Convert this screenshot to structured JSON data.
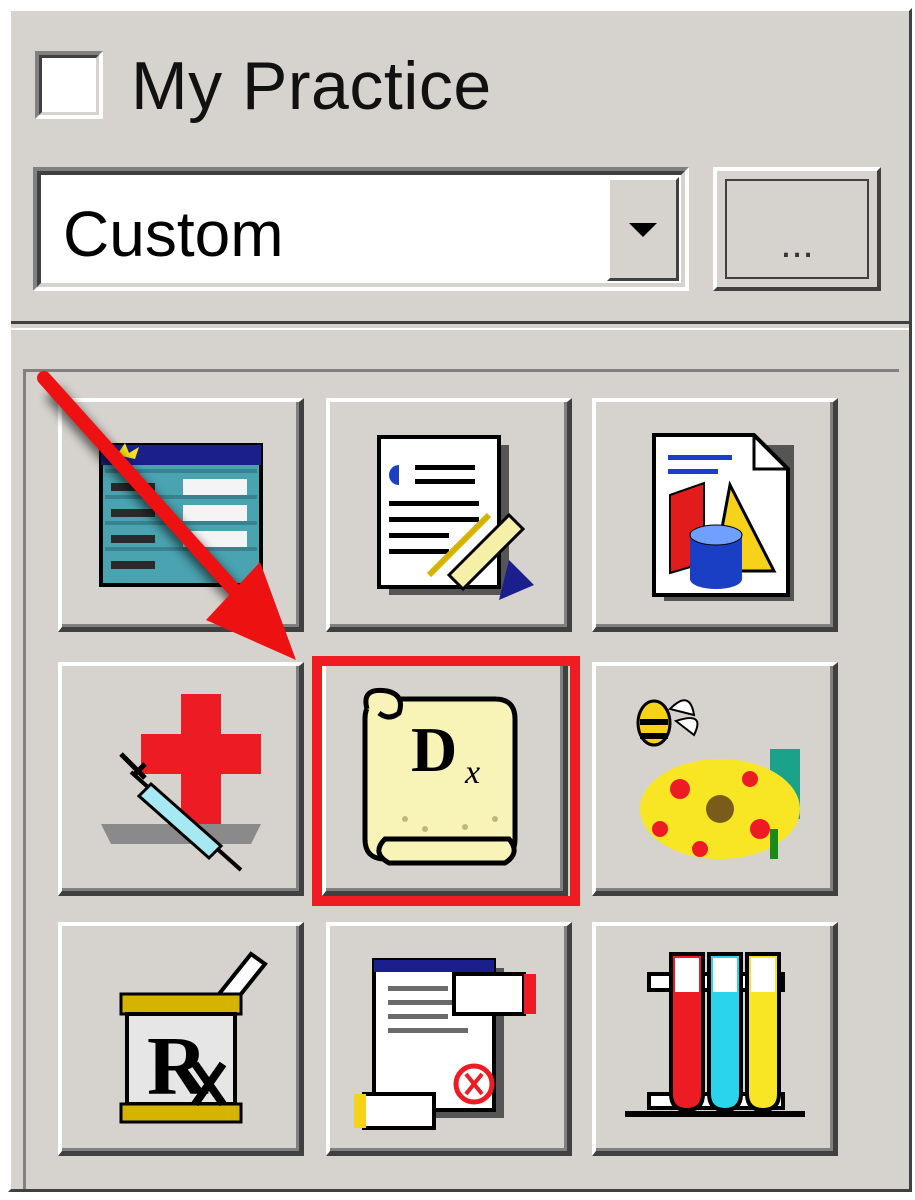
{
  "my_practice": {
    "label": "My Practice",
    "checked": false
  },
  "view_select": {
    "value": "Custom"
  },
  "more_button": {
    "label": "..."
  },
  "tiles": [
    {
      "icon": "schedule-grid-icon"
    },
    {
      "icon": "notes-writing-hand-icon"
    },
    {
      "icon": "documents-shapes-icon"
    },
    {
      "icon": "red-cross-syringe-icon"
    },
    {
      "icon": "dx-scroll-icon",
      "highlighted": true
    },
    {
      "icon": "allergy-bee-flower-icon"
    },
    {
      "icon": "rx-mortar-pestle-icon"
    },
    {
      "icon": "referral-document-icon"
    },
    {
      "icon": "lab-test-tubes-icon"
    }
  ],
  "dx_scroll_text": "D",
  "dx_scroll_sub": "x",
  "rx_text": "R",
  "colors": {
    "highlight": "#ef1c24",
    "arrow": "#ee1111",
    "panel": "#d6d3ce"
  }
}
